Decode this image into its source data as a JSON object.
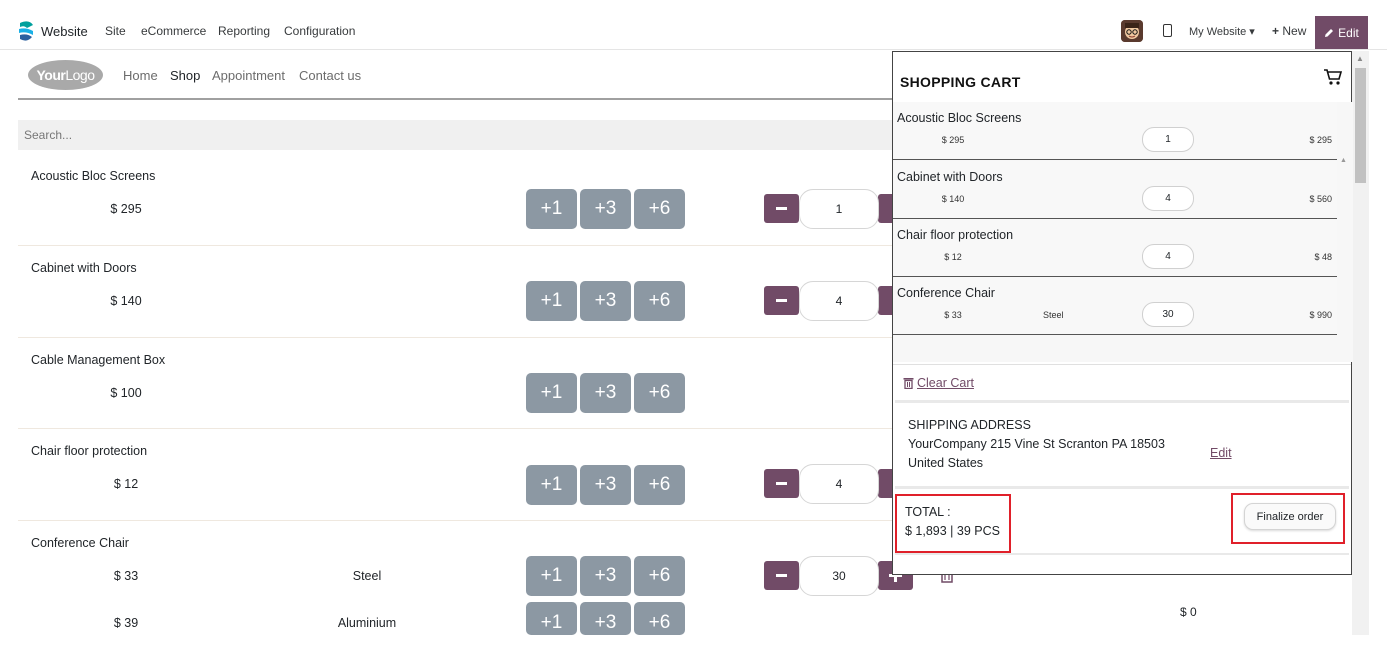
{
  "admin_bar": {
    "app_name": "Website",
    "menu": [
      "Site",
      "eCommerce",
      "Reporting",
      "Configuration"
    ],
    "my_website": "My Website ▾",
    "new_label": "New",
    "edit_label": "Edit",
    "edit_color": "#714b67"
  },
  "site_header": {
    "logo_text_bold": "Your",
    "logo_text_rest": "Logo",
    "nav": [
      "Home",
      "Shop",
      "Appointment",
      "Contact us"
    ],
    "active_nav": "Shop"
  },
  "search": {
    "placeholder": "Search..."
  },
  "quick_buttons": [
    "+1",
    "+3",
    "+6"
  ],
  "products": [
    {
      "name": "Acoustic Bloc Screens",
      "price": "$ 295",
      "qty": "1"
    },
    {
      "name": "Cabinet with Doors",
      "price": "$ 140",
      "qty": "4"
    },
    {
      "name": "Cable Management Box",
      "price": "$ 100"
    },
    {
      "name": "Chair floor protection",
      "price": "$ 12",
      "qty": "4"
    },
    {
      "name": "Conference Chair",
      "price": "$ 33",
      "variant": "Steel",
      "qty": "30"
    },
    {
      "price": "$ 39",
      "variant": "Aluminium",
      "line_total": "$ 0"
    }
  ],
  "cart": {
    "title": "SHOPPING CART",
    "items": [
      {
        "name": "Acoustic Bloc Screens",
        "price": "$ 295",
        "variant": "",
        "qty": "1",
        "total": "$ 295"
      },
      {
        "name": "Cabinet with Doors",
        "price": "$ 140",
        "variant": "",
        "qty": "4",
        "total": "$ 560"
      },
      {
        "name": "Chair floor protection",
        "price": "$ 12",
        "variant": "",
        "qty": "4",
        "total": "$ 48"
      },
      {
        "name": "Conference Chair",
        "price": "$ 33",
        "variant": "Steel",
        "qty": "30",
        "total": "$ 990"
      }
    ],
    "clear_label": "Clear Cart",
    "shipping_title": "SHIPPING ADDRESS",
    "shipping_line1": "YourCompany 215 Vine St Scranton PA 18503",
    "shipping_line2": "United States",
    "shipping_edit": "Edit",
    "total_label": "TOTAL :",
    "total_value": "$ 1,893 | 39 PCS",
    "finalize_label": "Finalize order",
    "highlight_color": "#e0202a"
  }
}
